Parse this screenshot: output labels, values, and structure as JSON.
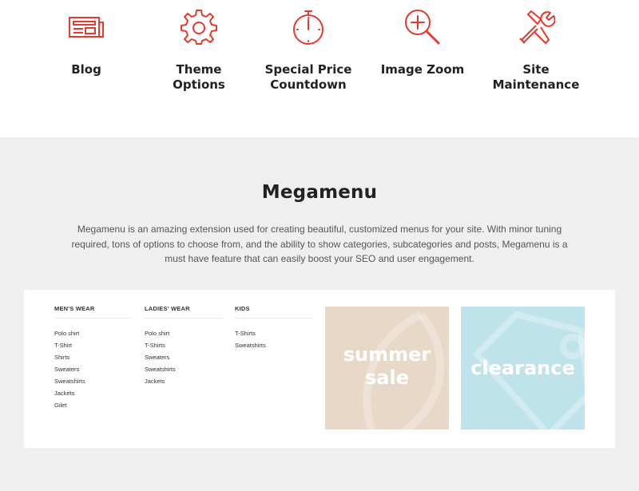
{
  "features": [
    {
      "icon": "newspaper-icon",
      "label": "Blog"
    },
    {
      "icon": "gear-icon",
      "label": "Theme\nOptions"
    },
    {
      "icon": "stopwatch-icon",
      "label": "Special Price\nCountdown"
    },
    {
      "icon": "zoom-in-icon",
      "label": "Image Zoom"
    },
    {
      "icon": "tools-icon",
      "label": "Site\nMaintenance"
    }
  ],
  "accent_color": "#e8392b",
  "megamenu": {
    "title": "Megamenu",
    "description": "Megamenu is an amazing extension used for creating beautiful, customized menus for your site. With minor tuning required, tons of options to choose from, and the ability to show categories, subcategories and posts, Megamenu is a must have feature that can easily boost your SEO and user engagement.",
    "columns": [
      {
        "title": "MEN'S WEAR",
        "items": [
          "Polo shirt",
          "T-Shirt",
          "Shirts",
          "Sweaters",
          "Sweatshirts",
          "Jackets",
          "Gilet"
        ]
      },
      {
        "title": "LADIES' WEAR",
        "items": [
          "Polo shirt",
          "T-Shirts",
          "Sweaters",
          "Sweatshirts",
          "Jackets"
        ]
      },
      {
        "title": "KIDS",
        "items": [
          "T-Shirts",
          "Sweatshirts"
        ]
      }
    ],
    "promos": [
      {
        "text": "summer\nsale",
        "color": "#e8d8c8"
      },
      {
        "text": "clearance",
        "color": "#bfe3ea"
      }
    ]
  }
}
